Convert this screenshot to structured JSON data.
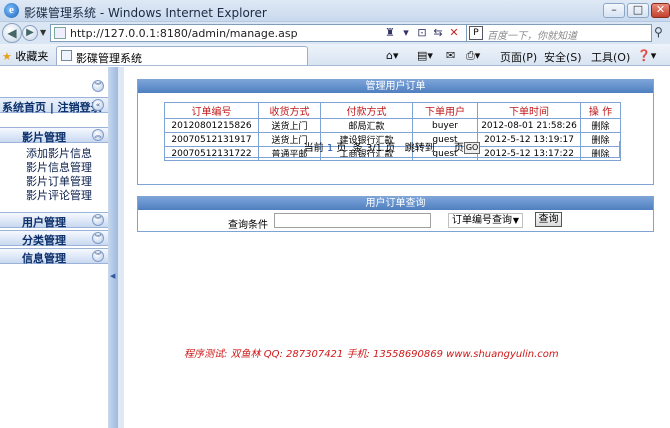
{
  "window": {
    "title": "影碟管理系统 - Windows Internet Explorer"
  },
  "address": {
    "url": "http://127.0.0.1:8180/admin/manage.asp"
  },
  "search": {
    "placeholder": "百度一下，你就知道"
  },
  "commandbar": {
    "favorites": "收藏夹",
    "tab_title": "影碟管理系统",
    "page_menu": "页面(P)",
    "safety_menu": "安全(S)",
    "tools_menu": "工具(O)"
  },
  "sidebar": {
    "home_logout": "系统首页 | 注销登录",
    "groups": [
      {
        "label": "影片管理",
        "expanded": true,
        "items": [
          "添加影片信息",
          "影片信息管理",
          "影片订单管理",
          "影片评论管理"
        ]
      },
      {
        "label": "用户管理",
        "expanded": false
      },
      {
        "label": "分类管理",
        "expanded": false
      },
      {
        "label": "信息管理",
        "expanded": false
      }
    ]
  },
  "orders_panel": {
    "title": "管理用户订单",
    "columns": [
      "订单编号",
      "收货方式",
      "付款方式",
      "下单用户",
      "下单时间",
      "操 作"
    ],
    "rows": [
      [
        "20120801215826",
        "送货上门",
        "邮局汇款",
        "buyer",
        "2012-08-01 21:58:26",
        "删除"
      ],
      [
        "20070512131917",
        "送货上门",
        "建设银行汇款",
        "guest",
        "2012-5-12 13:19:17",
        "删除"
      ],
      [
        "20070512131722",
        "普通平邮",
        "工商银行汇款",
        "guest",
        "2012-5-12 13:17:22",
        "删除"
      ]
    ],
    "pager": {
      "current_label": "当前",
      "current": "1",
      "page_unit": "页",
      "records_label": "条",
      "records": "3/1",
      "page_unit2": "页",
      "jump_label": "跳转到",
      "page_unit3": "页",
      "go": "GO"
    }
  },
  "query_panel": {
    "title": "用户订单查询",
    "condition_label": "查询条件",
    "condition_value": "",
    "select_value": "订单编号查询",
    "button": "查询"
  },
  "footer": {
    "text": "程序测试: 双鱼林  QQ: 287307421  手机: 13558690869  www.shuangyulin.com"
  }
}
